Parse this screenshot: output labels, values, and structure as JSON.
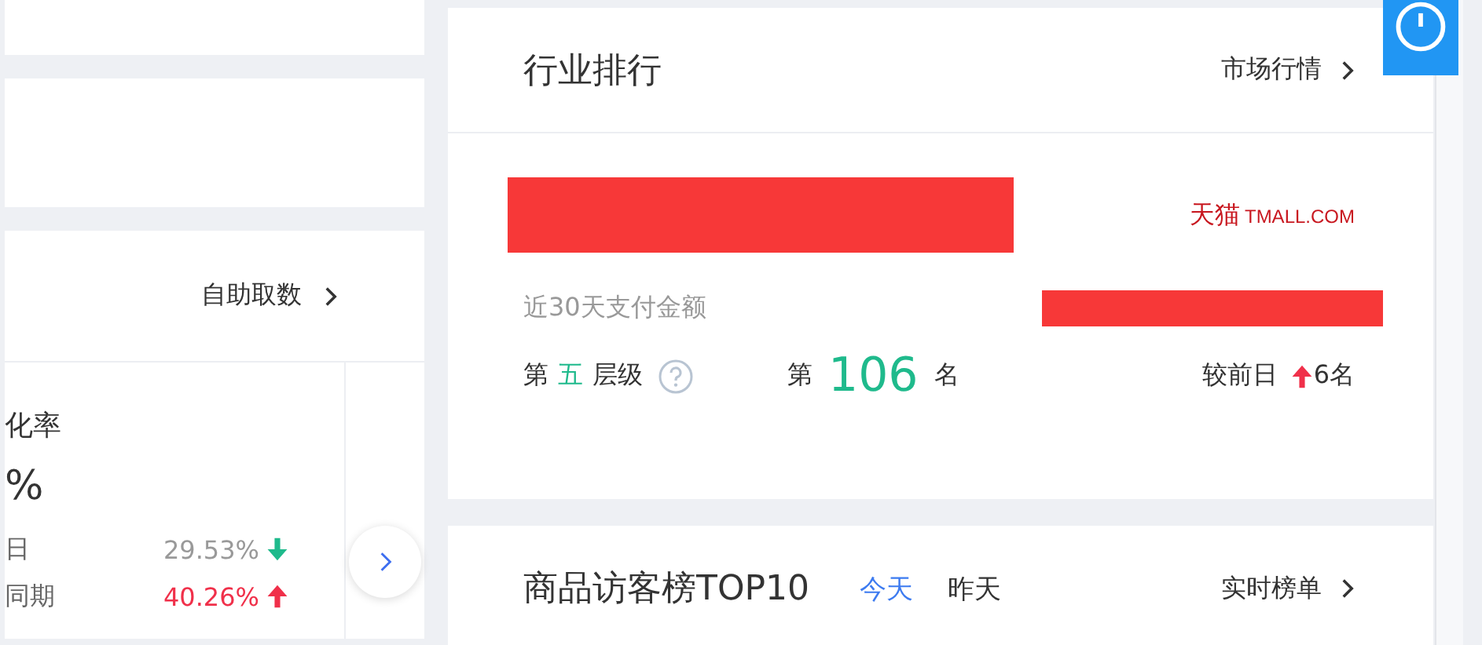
{
  "left_panel": {
    "link": "自助取数",
    "metric": {
      "label": "化率",
      "value": "%",
      "rows": [
        {
          "label": "日",
          "value": "29.53%",
          "kind": "down"
        },
        {
          "label": "同期",
          "value": "40.26%",
          "kind": "up"
        }
      ]
    }
  },
  "industry_rank": {
    "title": "行业排行",
    "link": "市场行情",
    "shop_name": {
      "redacted": true
    },
    "platform_logo": "天猫",
    "platform_domain": "TMALL.COM",
    "amount_label": "近30天支付金额",
    "amount": {
      "redacted": true
    },
    "tier_prefix": "第",
    "tier": "五",
    "tier_suffix": "层级",
    "rank_prefix": "第",
    "rank": "106",
    "rank_suffix": "名",
    "change_label": "较前日",
    "change": {
      "kind": "up",
      "value": "6名"
    }
  },
  "visitor_top": {
    "title": "商品访客榜TOP10",
    "tabs": [
      {
        "label": "今天",
        "selected": true
      },
      {
        "label": "昨天",
        "selected": false
      }
    ],
    "link": "实时榜单"
  }
}
